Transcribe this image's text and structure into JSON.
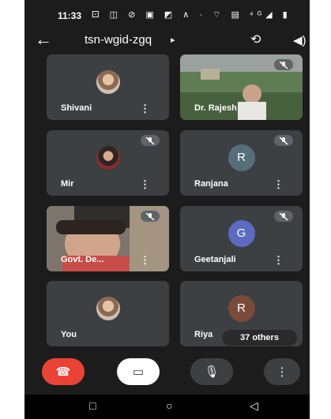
{
  "status_bar": {
    "time": "11:33",
    "icons": "⚀ ◫ ⊘ ▣ ◩ ∧ · ⌔ ▤ ⁴ᴳ◢ ▮"
  },
  "header": {
    "back_label": "←",
    "meeting_code": "tsn-wgid-zgq",
    "code_arrow": "▸",
    "switch_camera_label": "⟲",
    "audio_label": "◀)"
  },
  "participants": [
    {
      "name": "Shivani",
      "type": "photo",
      "muted": false
    },
    {
      "name": "Dr. Rajesh",
      "type": "video",
      "muted": true
    },
    {
      "name": "Mir",
      "type": "photo",
      "muted": true
    },
    {
      "name": "Ranjana",
      "type": "letter",
      "letter": "R",
      "avatar_color": "#546e7a",
      "muted": true
    },
    {
      "name": "Govt. De...",
      "type": "video",
      "muted": true
    },
    {
      "name": "Geetanjali",
      "type": "letter",
      "letter": "G",
      "avatar_color": "#5c6bc0",
      "muted": true
    },
    {
      "name": "You",
      "type": "photo",
      "muted": false
    },
    {
      "name": "Riya",
      "type": "letter",
      "letter": "R",
      "avatar_color": "#7a4b3a",
      "muted": false
    }
  ],
  "others_label": "37 others",
  "more_label": "⋮",
  "controls": {
    "end_call_label": "☎",
    "camera_label": "▭",
    "mic_label": "🎙",
    "more_label": "⋮"
  },
  "navbar": {
    "back": "◁",
    "home": "○",
    "recents": "□"
  },
  "colors": {
    "end_call": "#ea4335",
    "camera_off_bg": "#ffffff",
    "control_bg": "#3c4043",
    "tile_bg": "#3c4043"
  }
}
